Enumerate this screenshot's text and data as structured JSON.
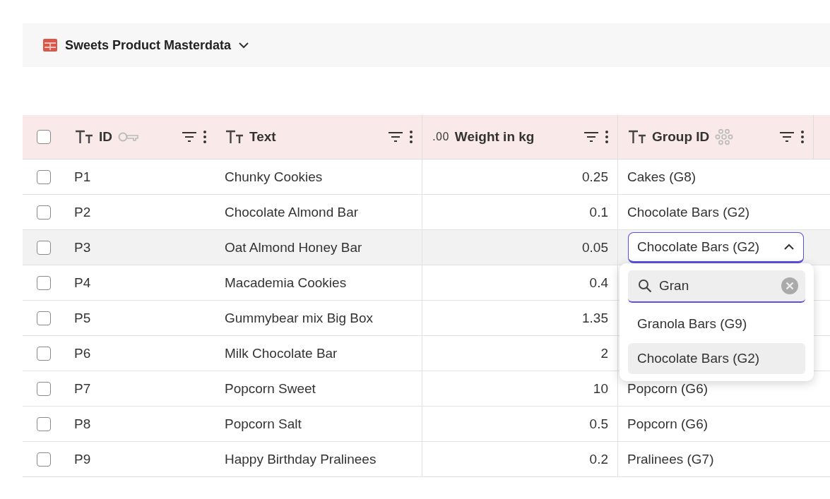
{
  "title": "Sweets Product Masterdata",
  "columns": [
    {
      "label": "ID",
      "kind": "key"
    },
    {
      "label": "Text",
      "kind": "text"
    },
    {
      "label": "Weight in kg",
      "kind": "number",
      "type_label": ".00"
    },
    {
      "label": "Group ID",
      "kind": "link"
    }
  ],
  "header_checked": false,
  "rows": [
    {
      "checked": false,
      "selected": false,
      "cells": [
        "P1",
        "Chunky Cookies",
        "0.25",
        "Cakes (G8)"
      ]
    },
    {
      "checked": false,
      "selected": false,
      "cells": [
        "P2",
        "Chocolate Almond Bar",
        "0.1",
        "Chocolate Bars (G2)"
      ]
    },
    {
      "checked": false,
      "selected": true,
      "cells": [
        "P3",
        "Oat Almond Honey Bar",
        "0.05",
        "Chocolate Bars (G2)"
      ],
      "editing": true
    },
    {
      "checked": false,
      "selected": false,
      "cells": [
        "P4",
        "Macademia Cookies",
        "0.4"
      ]
    },
    {
      "checked": false,
      "selected": false,
      "cells": [
        "P5",
        "Gummybear mix Big Box",
        "1.35"
      ]
    },
    {
      "checked": false,
      "selected": false,
      "cells": [
        "P6",
        "Milk Chocolate Bar",
        "2"
      ]
    },
    {
      "checked": false,
      "selected": false,
      "cells": [
        "P7",
        "Popcorn Sweet",
        "10",
        "Popcorn (G6)"
      ]
    },
    {
      "checked": false,
      "selected": false,
      "cells": [
        "P8",
        "Popcorn Salt",
        "0.5",
        "Popcorn (G6)"
      ]
    },
    {
      "checked": false,
      "selected": false,
      "cells": [
        "P9",
        "Happy Birthday Pralinees",
        "0.2",
        "Pralinees (G7)"
      ]
    }
  ],
  "dropdown": {
    "expanded": true,
    "search_value": "Gran",
    "options": [
      {
        "label": "Granola Bars (G9)",
        "selected": false
      },
      {
        "label": "Chocolate Bars (G2)",
        "selected": true
      }
    ]
  }
}
